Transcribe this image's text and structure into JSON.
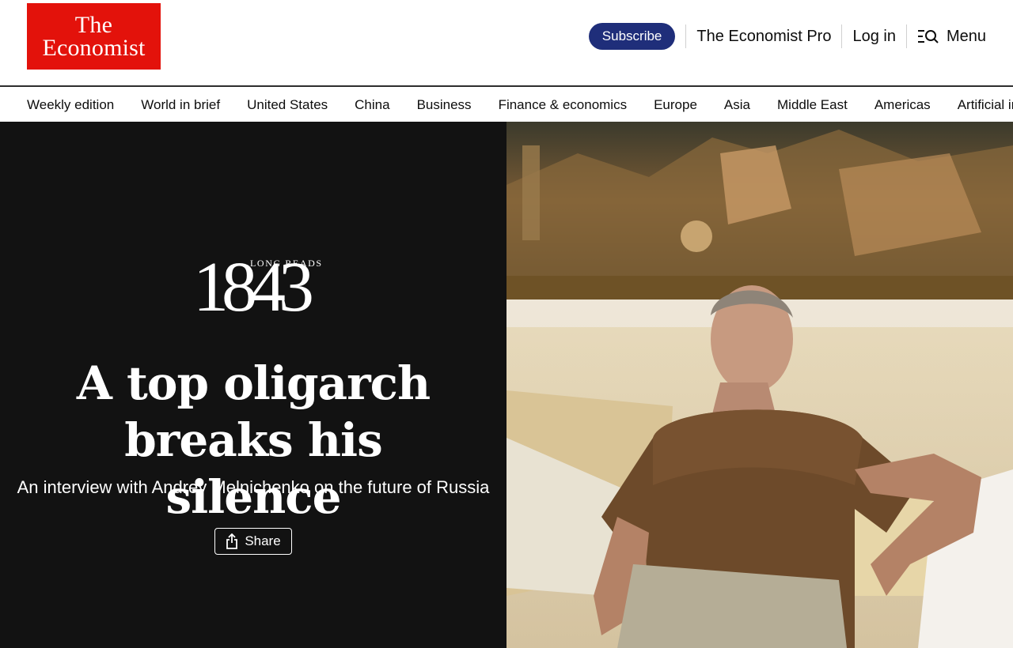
{
  "header": {
    "logo_line1": "The",
    "logo_line2": "Economist",
    "subscribe_label": "Subscribe",
    "pro_label": "The Economist Pro",
    "login_label": "Log in",
    "menu_label": "Menu"
  },
  "nav": {
    "items": [
      "Weekly edition",
      "World in brief",
      "United States",
      "China",
      "Business",
      "Finance & economics",
      "Europe",
      "Asia",
      "Middle East",
      "Americas",
      "Artificial intelligence"
    ]
  },
  "hero": {
    "badge_number": "1843",
    "badge_label": "LONG READS",
    "headline_line1": "A top oligarch",
    "headline_line2": "breaks his silence",
    "dek": "An interview with Andrey Melnichenko on the future of Russia",
    "share_label": "Share"
  },
  "colors": {
    "brand_red": "#e3120b",
    "subscribe_blue": "#1f2e7a",
    "hero_background": "#121212"
  },
  "icons": [
    "search-menu-icon",
    "share-icon"
  ]
}
